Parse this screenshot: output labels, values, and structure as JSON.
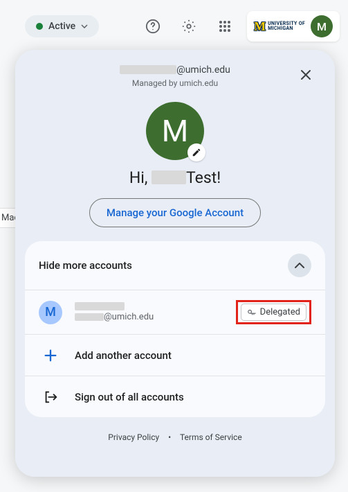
{
  "topbar": {
    "status_label": "Active",
    "org_line1": "UNIVERSITY OF",
    "org_line2": "MICHIGAN",
    "avatar_initial": "M"
  },
  "sliver": {
    "text": "Mad"
  },
  "panel": {
    "email_suffix": "@umich.edu",
    "managed_text": "Managed by umich.edu",
    "avatar_initial": "M",
    "greeting_prefix": "Hi, ",
    "greeting_suffix": "Test!",
    "manage_button": "Manage your Google Account",
    "hide_accounts": "Hide more accounts",
    "accounts": [
      {
        "initial": "M",
        "email_suffix": "@umich.edu",
        "badge": "Delegated"
      }
    ],
    "add_account": "Add another account",
    "sign_out": "Sign out of all accounts"
  },
  "footer": {
    "privacy": "Privacy Policy",
    "terms": "Terms of Service"
  }
}
